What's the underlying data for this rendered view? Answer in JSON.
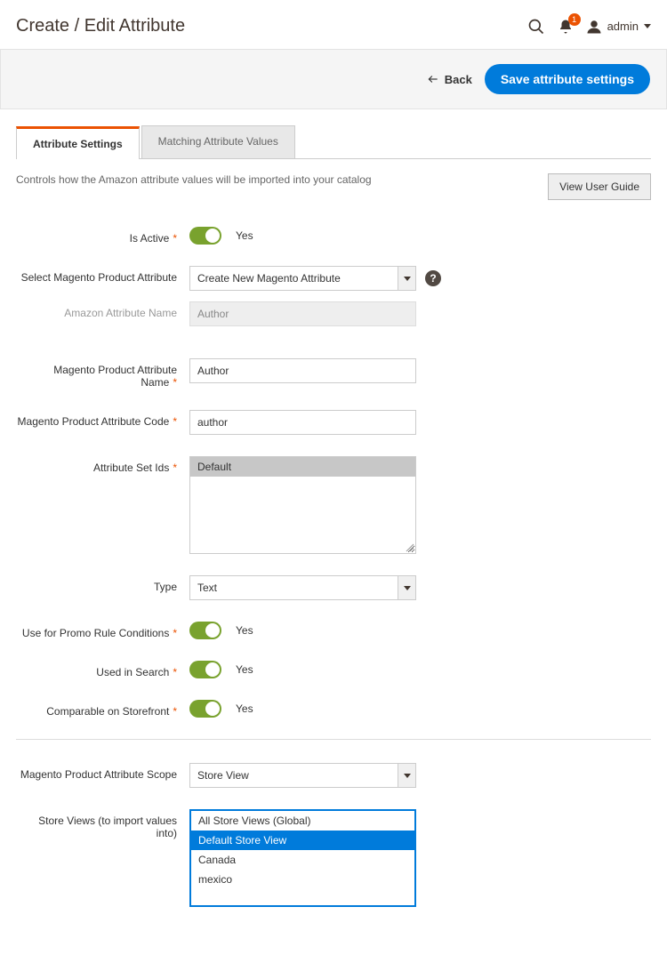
{
  "header": {
    "title": "Create / Edit Attribute",
    "notification_count": "1",
    "user_label": "admin"
  },
  "action_bar": {
    "back_label": "Back",
    "save_label": "Save attribute settings"
  },
  "tabs": {
    "active": "Attribute Settings",
    "inactive": "Matching Attribute Values"
  },
  "intro": {
    "text": "Controls how the Amazon attribute values will be imported into your catalog",
    "guide_button": "View User Guide"
  },
  "form": {
    "is_active": {
      "label": "Is Active",
      "value": "Yes"
    },
    "select_magento_attr": {
      "label": "Select Magento Product Attribute",
      "value": "Create New Magento Attribute"
    },
    "amazon_attr_name": {
      "label": "Amazon Attribute Name",
      "value": "Author"
    },
    "magento_attr_name": {
      "label": "Magento Product Attribute Name",
      "value": "Author"
    },
    "magento_attr_code": {
      "label": "Magento Product Attribute Code",
      "value": "author"
    },
    "attribute_set_ids": {
      "label": "Attribute Set Ids",
      "options": [
        "Default"
      ],
      "selected": "Default"
    },
    "type": {
      "label": "Type",
      "value": "Text"
    },
    "promo_rule": {
      "label": "Use for Promo Rule Conditions",
      "value": "Yes"
    },
    "used_in_search": {
      "label": "Used in Search",
      "value": "Yes"
    },
    "comparable": {
      "label": "Comparable on Storefront",
      "value": "Yes"
    },
    "scope": {
      "label": "Magento Product Attribute Scope",
      "value": "Store View"
    },
    "store_views": {
      "label": "Store Views (to import values into)",
      "options": [
        "All Store Views (Global)",
        "Default Store View",
        "Canada",
        "mexico"
      ],
      "selected": "Default Store View"
    }
  }
}
